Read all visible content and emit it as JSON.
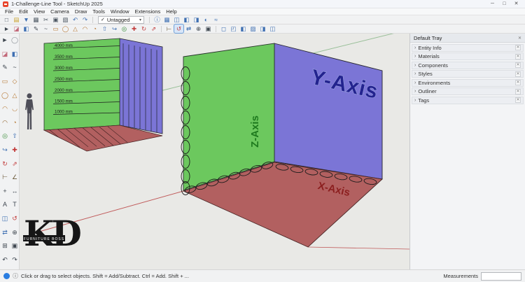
{
  "window": {
    "title": "1-Challenge-Line Tool - SketchUp 2025",
    "minimize": "─",
    "maximize": "□",
    "close": "✕"
  },
  "menubar": {
    "items": [
      "File",
      "Edit",
      "View",
      "Camera",
      "Draw",
      "Tools",
      "Window",
      "Extensions",
      "Help"
    ]
  },
  "toolbar_top": {
    "left_icons": [
      {
        "name": "new-file-icon",
        "glyph": "□",
        "color": "#4a5560"
      },
      {
        "name": "open-file-icon",
        "glyph": "▤",
        "color": "#c9a227"
      },
      {
        "name": "save-icon",
        "glyph": "▼",
        "color": "#3e6fb2"
      },
      {
        "name": "print-icon",
        "glyph": "▦",
        "color": "#4a5560"
      },
      {
        "name": "cut-icon",
        "glyph": "✂",
        "color": "#4a5560"
      },
      {
        "name": "copy-icon",
        "glyph": "▣",
        "color": "#4a5560"
      },
      {
        "name": "paste-icon",
        "glyph": "▧",
        "color": "#4a5560"
      },
      {
        "name": "undo-icon",
        "glyph": "↶",
        "color": "#3e6fb2"
      },
      {
        "name": "redo-icon",
        "glyph": "↷",
        "color": "#3e6fb2"
      }
    ],
    "tag_dropdown": {
      "check": "✓",
      "value": "Untagged",
      "caret": "▾"
    },
    "right_icons": [
      {
        "name": "entity-info-icon",
        "glyph": "ⓘ",
        "color": "#3e6fb2"
      },
      {
        "name": "model-info-icon",
        "glyph": "▦",
        "color": "#3e6fb2"
      },
      {
        "name": "components-panel-icon",
        "glyph": "◫",
        "color": "#3e6fb2"
      },
      {
        "name": "materials-panel-icon",
        "glyph": "◧",
        "color": "#3e6fb2"
      },
      {
        "name": "styles-panel-icon",
        "glyph": "◨",
        "color": "#3e6fb2"
      },
      {
        "name": "shadows-icon",
        "glyph": "◐",
        "color": "#3e6fb2"
      },
      {
        "name": "fog-icon",
        "glyph": "≈",
        "color": "#3e6fb2"
      }
    ]
  },
  "toolbar_draw": {
    "tool_icons": [
      {
        "name": "select-tool-icon",
        "glyph": "►",
        "color": "#3f4750"
      },
      {
        "name": "eraser-tool-icon",
        "glyph": "◪",
        "color": "#c2697a"
      },
      {
        "name": "paint-bucket-icon",
        "glyph": "◧",
        "color": "#3e6fb2"
      },
      {
        "name": "line-tool-icon",
        "glyph": "✎",
        "color": "#3f4750"
      },
      {
        "name": "freehand-tool-icon",
        "glyph": "~",
        "color": "#3f4750"
      },
      {
        "name": "rectangle-tool-icon",
        "glyph": "▭",
        "color": "#b5752f"
      },
      {
        "name": "circle-tool-icon",
        "glyph": "◯",
        "color": "#b5752f"
      },
      {
        "name": "polygon-tool-icon",
        "glyph": "△",
        "color": "#b5752f"
      },
      {
        "name": "arc-tool-icon",
        "glyph": "◠",
        "color": "#b5752f"
      },
      {
        "name": "pie-tool-icon",
        "glyph": "◔",
        "color": "#b5752f"
      },
      {
        "name": "push-pull-tool-icon",
        "glyph": "⇧",
        "color": "#3e6fb2"
      },
      {
        "name": "follow-me-tool-icon",
        "glyph": "↪",
        "color": "#3e6fb2"
      },
      {
        "name": "offset-tool-icon",
        "glyph": "◎",
        "color": "#3e8f3e"
      },
      {
        "name": "move-tool-icon",
        "glyph": "✚",
        "color": "#c23a3a"
      },
      {
        "name": "rotate-tool-icon",
        "glyph": "↻",
        "color": "#c23a3a"
      },
      {
        "name": "scale-tool-icon",
        "glyph": "⇗",
        "color": "#c23a3a"
      }
    ],
    "camera_icons": [
      {
        "name": "tape-measure-icon",
        "glyph": "⊢",
        "color": "#6b5a3a"
      },
      {
        "name": "orbit-tool-icon",
        "glyph": "↺",
        "color": "#c23a3a",
        "active": "true"
      },
      {
        "name": "pan-tool-icon",
        "glyph": "⇄",
        "color": "#3e6fb2"
      },
      {
        "name": "zoom-tool-icon",
        "glyph": "⊕",
        "color": "#3f4750"
      },
      {
        "name": "zoom-extents-icon",
        "glyph": "▣",
        "color": "#3f4750"
      }
    ],
    "style_icons": [
      {
        "name": "wireframe-style-icon",
        "glyph": "◻",
        "color": "#3e6fb2"
      },
      {
        "name": "hidden-line-style-icon",
        "glyph": "◰",
        "color": "#3e6fb2"
      },
      {
        "name": "shaded-style-icon",
        "glyph": "◧",
        "color": "#3e6fb2"
      },
      {
        "name": "shaded-textures-style-icon",
        "glyph": "▨",
        "color": "#3e6fb2"
      },
      {
        "name": "monochrome-style-icon",
        "glyph": "◨",
        "color": "#3e6fb2"
      },
      {
        "name": "x-ray-style-icon",
        "glyph": "◫",
        "color": "#3e6fb2"
      }
    ]
  },
  "palette": {
    "icons": [
      {
        "name": "select-tool-icon",
        "glyph": "►",
        "color": "#3f4750"
      },
      {
        "name": "lasso-select-icon",
        "glyph": "◯",
        "color": "#8a8f96"
      },
      {
        "name": "eraser-tool-icon",
        "glyph": "◪",
        "color": "#c2697a"
      },
      {
        "name": "paint-bucket-icon",
        "glyph": "◧",
        "color": "#3e6fb2"
      },
      {
        "name": "line-tool-icon",
        "glyph": "✎",
        "color": "#3f4750"
      },
      {
        "name": "freehand-tool-icon",
        "glyph": "~",
        "color": "#3f4750"
      },
      {
        "name": "rectangle-tool-icon",
        "glyph": "▭",
        "color": "#b5752f"
      },
      {
        "name": "rotated-rectangle-icon",
        "glyph": "◇",
        "color": "#b5752f"
      },
      {
        "name": "circle-tool-icon",
        "glyph": "◯",
        "color": "#b5752f"
      },
      {
        "name": "polygon-tool-icon",
        "glyph": "△",
        "color": "#b5752f"
      },
      {
        "name": "arc-tool-icon",
        "glyph": "◠",
        "color": "#b5752f"
      },
      {
        "name": "two-point-arc-icon",
        "glyph": "◡",
        "color": "#b5752f"
      },
      {
        "name": "three-point-arc-icon",
        "glyph": "◠",
        "color": "#8a5a20"
      },
      {
        "name": "pie-tool-icon",
        "glyph": "◔",
        "color": "#b5752f"
      },
      {
        "name": "offset-tool-icon",
        "glyph": "◎",
        "color": "#3e8f3e"
      },
      {
        "name": "push-pull-tool-icon",
        "glyph": "⇧",
        "color": "#3e6fb2"
      },
      {
        "name": "follow-me-tool-icon",
        "glyph": "↪",
        "color": "#3e6fb2"
      },
      {
        "name": "move-tool-icon",
        "glyph": "✚",
        "color": "#c23a3a"
      },
      {
        "name": "rotate-tool-icon",
        "glyph": "↻",
        "color": "#c23a3a"
      },
      {
        "name": "scale-tool-icon",
        "glyph": "⇗",
        "color": "#c23a3a"
      },
      {
        "name": "tape-measure-icon",
        "glyph": "⊢",
        "color": "#6b5a3a"
      },
      {
        "name": "protractor-tool-icon",
        "glyph": "∠",
        "color": "#6b5a3a"
      },
      {
        "name": "axes-tool-icon",
        "glyph": "+",
        "color": "#3f4750"
      },
      {
        "name": "dimension-tool-icon",
        "glyph": "↔",
        "color": "#3f4750"
      },
      {
        "name": "text-tool-icon",
        "glyph": "A",
        "color": "#3f4750"
      },
      {
        "name": "3d-text-tool-icon",
        "glyph": "T",
        "color": "#3f4750"
      },
      {
        "name": "section-plane-icon",
        "glyph": "◫",
        "color": "#3e6fb2"
      },
      {
        "name": "orbit-tool-icon",
        "glyph": "↺",
        "color": "#c23a3a"
      },
      {
        "name": "pan-tool-icon",
        "glyph": "⇄",
        "color": "#3e6fb2"
      },
      {
        "name": "zoom-tool-icon",
        "glyph": "⊕",
        "color": "#3f4750"
      },
      {
        "name": "zoom-window-icon",
        "glyph": "⊞",
        "color": "#3f4750"
      },
      {
        "name": "zoom-extents-icon",
        "glyph": "▣",
        "color": "#3f4750"
      },
      {
        "name": "previous-view-icon",
        "glyph": "↶",
        "color": "#3f4750"
      },
      {
        "name": "next-view-icon",
        "glyph": "↷",
        "color": "#3f4750"
      }
    ]
  },
  "viewport": {
    "measurements": [
      "4000 mm",
      "3500 mm",
      "3000 mm",
      "2500 mm",
      "2000 mm",
      "1500 mm",
      "1000 mm"
    ],
    "axis_labels": {
      "x": "X-Axis",
      "y": "Y-Axis",
      "z": "Z-Axis"
    },
    "logo": {
      "initials": "KD",
      "caption": "FURNITURE BOSS"
    },
    "colors": {
      "wall_green": "#6cc85e",
      "wall_blue": "#7b75d6",
      "floor_red": "#b26060",
      "axis_x_text": "#8c1f1f",
      "axis_y_text": "#23238f",
      "axis_z_text": "#1e7a1e"
    }
  },
  "tray": {
    "title": "Default Tray",
    "chevron": "›",
    "close_glyph": "✕",
    "sections": [
      {
        "label": "Entity Info"
      },
      {
        "label": "Materials"
      },
      {
        "label": "Components"
      },
      {
        "label": "Styles"
      },
      {
        "label": "Environments"
      },
      {
        "label": "Outliner"
      },
      {
        "label": "Tags"
      }
    ]
  },
  "statusbar": {
    "info_glyph": "ⓘ",
    "hint": "Click or drag to select objects. Shift = Add/Subtract. Ctrl = Add. Shift + ...",
    "measurements_label": "Measurements",
    "measurements_value": ""
  }
}
